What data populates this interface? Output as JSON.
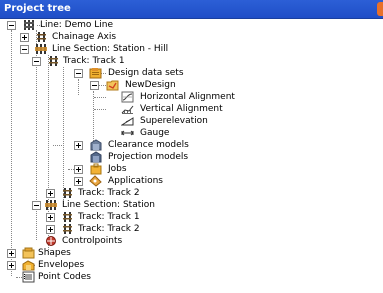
{
  "panel": {
    "title": "Project tree"
  },
  "tree": [
    {
      "label": "Line: Demo Line",
      "icon": "line-icon",
      "expander": "expanded"
    },
    {
      "label": "Chainage Axis",
      "icon": "chainage-axis-icon",
      "expander": "collapsed"
    },
    {
      "label": "Line Section: Station - Hill",
      "icon": "line-section-icon",
      "expander": "expanded"
    },
    {
      "label": "Track: Track 1",
      "icon": "track-icon",
      "expander": "expanded"
    },
    {
      "label": "Design data sets",
      "icon": "design-data-sets-icon",
      "expander": "expanded"
    },
    {
      "label": "NewDesign",
      "icon": "design-folder-icon",
      "expander": "expanded"
    },
    {
      "label": "Horizontal Alignment",
      "icon": "horizontal-alignment-icon",
      "expander": "none"
    },
    {
      "label": "Vertical Alignment",
      "icon": "vertical-alignment-icon",
      "expander": "none"
    },
    {
      "label": "Superelevation",
      "icon": "superelevation-icon",
      "expander": "none"
    },
    {
      "label": "Gauge",
      "icon": "gauge-icon",
      "expander": "none"
    },
    {
      "label": "Clearance models",
      "icon": "clearance-models-icon",
      "expander": "collapsed"
    },
    {
      "label": "Projection models",
      "icon": "projection-models-icon",
      "expander": "none"
    },
    {
      "label": "Jobs",
      "icon": "jobs-icon",
      "expander": "collapsed"
    },
    {
      "label": "Applications",
      "icon": "applications-icon",
      "expander": "collapsed"
    },
    {
      "label": "Track: Track 2",
      "icon": "track-icon",
      "expander": "collapsed"
    },
    {
      "label": "Line Section: Station",
      "icon": "line-section-icon",
      "expander": "expanded"
    },
    {
      "label": "Track: Track 1",
      "icon": "track-icon",
      "expander": "collapsed"
    },
    {
      "label": "Track: Track 2",
      "icon": "track-icon",
      "expander": "collapsed"
    },
    {
      "label": "Controlpoints",
      "icon": "controlpoints-icon",
      "expander": "none"
    },
    {
      "label": "Shapes",
      "icon": "shapes-icon",
      "expander": "collapsed"
    },
    {
      "label": "Envelopes",
      "icon": "envelopes-icon",
      "expander": "collapsed"
    },
    {
      "label": "Point Codes",
      "icon": "point-codes-icon",
      "expander": "none"
    }
  ]
}
